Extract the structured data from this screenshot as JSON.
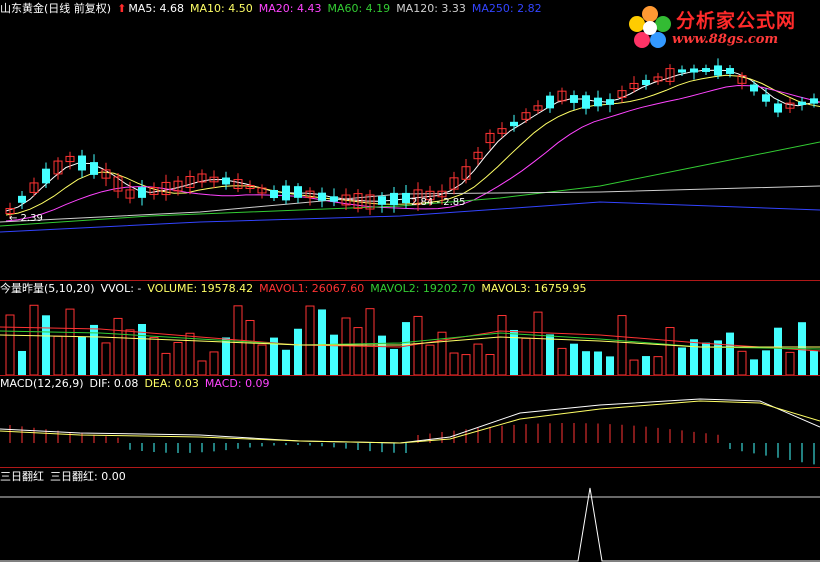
{
  "header_main": {
    "title": "山东黄金(日线 前复权)",
    "indicators": [
      {
        "label": "MA5: 4.68",
        "color": "#ffffff"
      },
      {
        "label": "MA10: 4.50",
        "color": "#ffff66"
      },
      {
        "label": "MA20: 4.43",
        "color": "#ff44ff"
      },
      {
        "label": "MA60: 4.19",
        "color": "#33cc33"
      },
      {
        "label": "MA120: 3.33",
        "color": "#d0d0d0"
      },
      {
        "label": "MA250: 2.82",
        "color": "#3344ff"
      }
    ]
  },
  "header_vol": {
    "title": "今量昨量(5,10,20)",
    "items": [
      {
        "label": "VVOL: -",
        "color": "#ffffff"
      },
      {
        "label": "VOLUME: 19578.42",
        "color": "#ffff66"
      },
      {
        "label": "MAVOL1: 26067.60",
        "color": "#ff3333"
      },
      {
        "label": "MAVOL2: 19202.70",
        "color": "#33cc33"
      },
      {
        "label": "MAVOL3: 16759.95",
        "color": "#ffff66"
      }
    ]
  },
  "header_macd": {
    "title": "MACD(12,26,9)",
    "items": [
      {
        "label": "DIF: 0.08",
        "color": "#ffffff"
      },
      {
        "label": "DEA: 0.03",
        "color": "#ffff66"
      },
      {
        "label": "MACD: 0.09",
        "color": "#ff44ff"
      }
    ]
  },
  "header_sanri": {
    "title": "三日翻红",
    "item": "三日翻红: 0.00"
  },
  "annotations": {
    "low": "← 2.39",
    "range": "2.84 - 2.85"
  },
  "logo": {
    "title": "分析家公式网",
    "url": "www.88gs.com"
  },
  "colors": {
    "up": "#ff3333",
    "down": "#44ffff",
    "ma5": "#ffffff",
    "ma10": "#ffff66",
    "ma20": "#ff44ff",
    "ma60": "#33cc33",
    "ma120": "#d0d0d0",
    "ma250": "#3344ff"
  }
}
